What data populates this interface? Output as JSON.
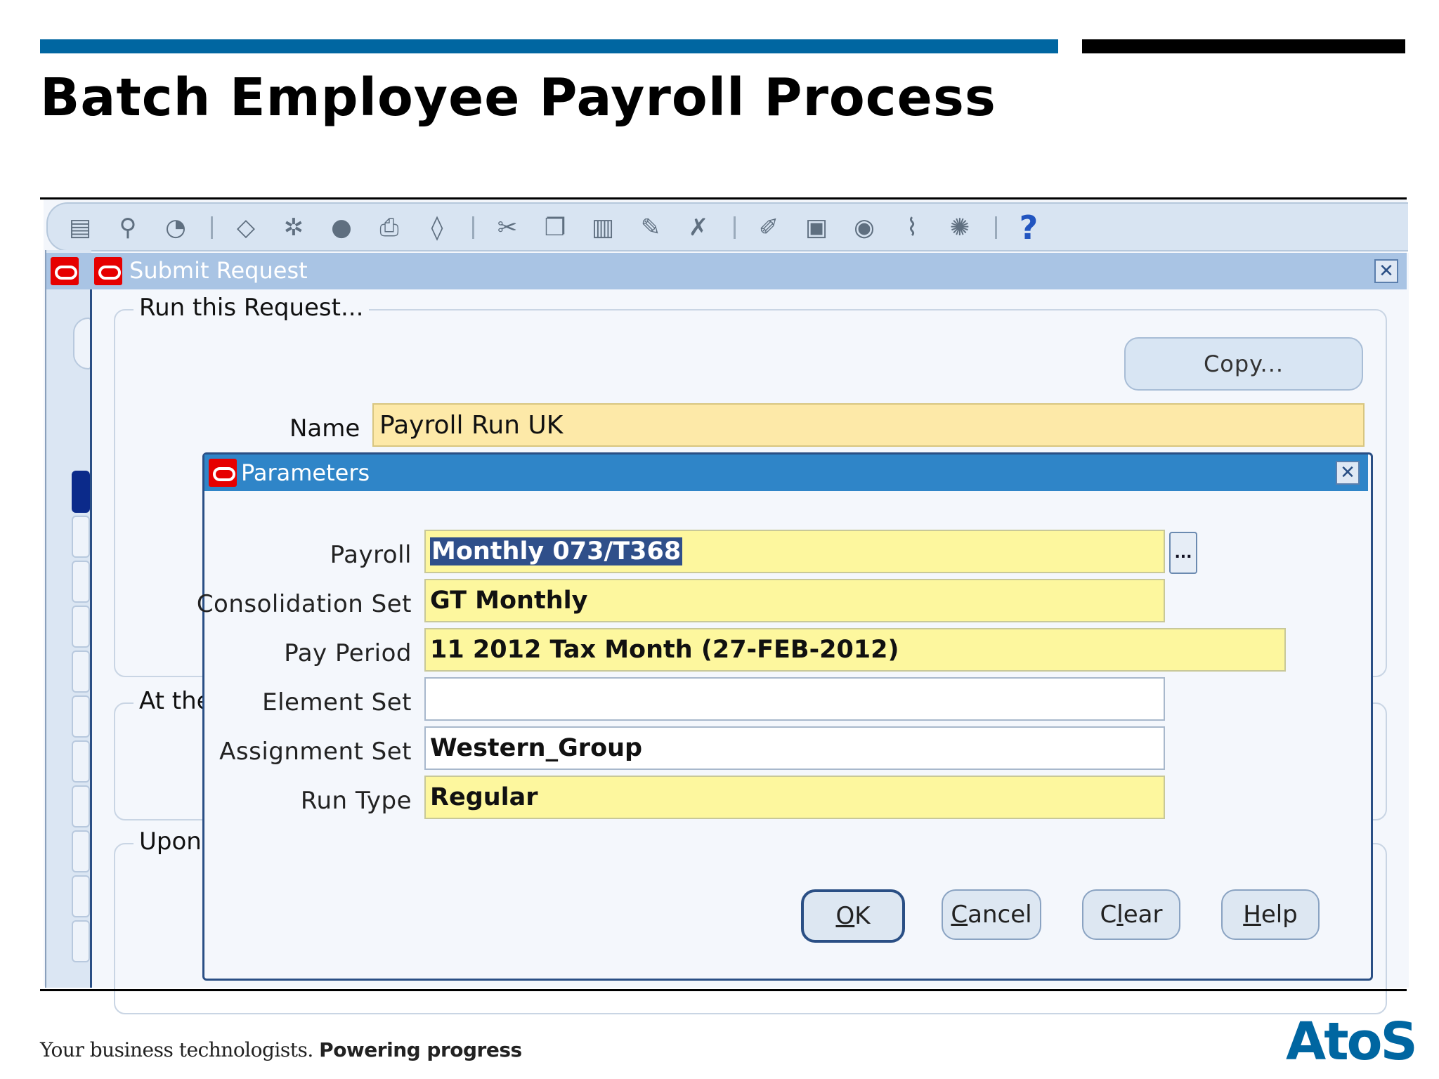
{
  "slide": {
    "title": "Batch Employee Payroll Process",
    "footer_tagline": "Your business technologists.",
    "footer_tagline_bold": "Powering progress",
    "brand": "AtoS",
    "colors": {
      "brand_blue": "#0066a1",
      "accent_black": "#000000"
    }
  },
  "toolbar": {
    "icons": [
      "new-record-icon",
      "find-icon",
      "navigator-icon",
      "save-icon",
      "next-step-icon",
      "switch-responsibility-icon",
      "print-icon",
      "close-form-icon",
      "cut-icon",
      "copy-icon",
      "paste-icon",
      "new-icon",
      "clear-record-icon",
      "edit-field-icon",
      "zoom-icon",
      "translations-icon",
      "attachments-icon",
      "folder-tools-icon",
      "help-icon"
    ],
    "help_glyph": "?"
  },
  "submit_request": {
    "title": "Submit Request",
    "run_group_label": "Run this Request...",
    "copy_button": "Copy...",
    "name_label": "Name",
    "name_value": "Payroll Run UK",
    "at_the_label": "At the",
    "upon_label": "Upon"
  },
  "parameters": {
    "title": "Parameters",
    "fields": {
      "payroll": {
        "label": "Payroll",
        "value": "Monthly 073/T368"
      },
      "consolidation_set": {
        "label": "Consolidation Set",
        "value": "GT Monthly"
      },
      "pay_period": {
        "label": "Pay Period",
        "value": "11 2012 Tax Month (27-FEB-2012)"
      },
      "element_set": {
        "label": "Element Set",
        "value": ""
      },
      "assignment_set": {
        "label": "Assignment Set",
        "value": "Western_Group"
      },
      "run_type": {
        "label": "Run Type",
        "value": "Regular"
      }
    },
    "lov_glyph": "...",
    "buttons": {
      "ok": {
        "mnemonic": "O",
        "rest": "K"
      },
      "cancel": {
        "mnemonic": "C",
        "rest": "ancel"
      },
      "clear": {
        "mnemonic": "",
        "first": "C",
        "mn": "l",
        "rest": "ear"
      },
      "help": {
        "mnemonic": "H",
        "rest": "elp"
      }
    }
  }
}
